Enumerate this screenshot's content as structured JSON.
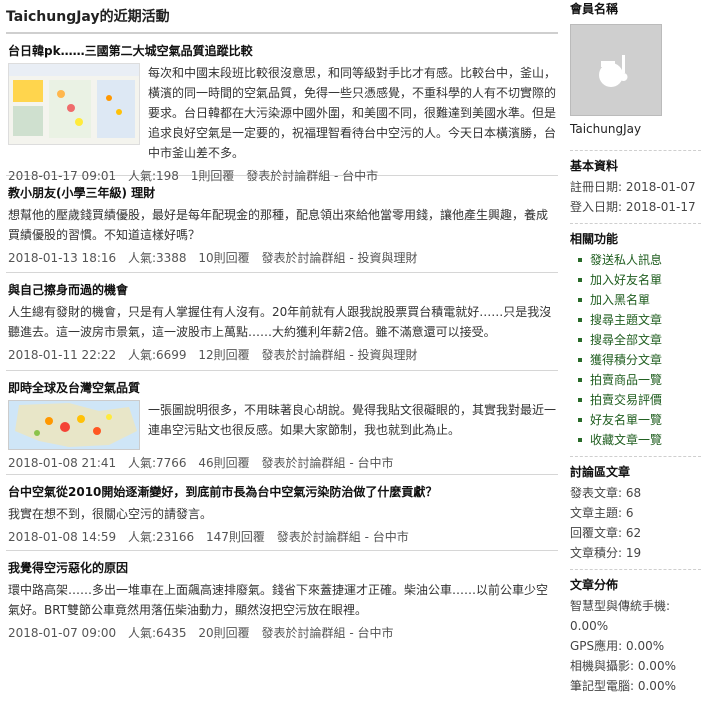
{
  "header": {
    "title": "TaichungJay的近期活動"
  },
  "posts": [
    {
      "title": "台日韓pk……三國第二大城空氣品質追蹤比較",
      "body": "每次和中國末段班比較很沒意思，和同等級對手比才有感。比較台中，釜山，橫濱的同一時間的空氣品質，免得一些只憑感覺，不重科學的人有不切實際的要求。台日韓都在大污染源中國外圍，和美國不同，很難達到美國水準。但是追求良好空氣是一定要的，祝福理智看待台中空污的人。今天日本橫濱勝，台中市釜山差不多。",
      "date": "2018-01-17 09:01",
      "views": "人氣:198",
      "replies": "1則回覆",
      "forum": "發表於討論群組 - 台中市"
    },
    {
      "title": "教小朋友(小學三年級) 理財",
      "body": "想幫他的壓歲錢買績優股，最好是每年配現金的那種，配息領出來給他當零用錢，讓他產生興趣，養成買績優股的習慣。不知道這樣好嗎？",
      "date": "2018-01-13 18:16",
      "views": "人氣:3388",
      "replies": "10則回覆",
      "forum": "發表於討論群組 - 投資與理財"
    },
    {
      "title": "與自己擦身而過的機會",
      "body": "人生總有發財的機會，只是有人掌握住有人沒有。20年前就有人跟我說股票買台積電就好……只是我沒聽進去。這一波房市景氣，這一波股市上萬點……大約獲利年薪2倍。雖不滿意還可以接受。",
      "date": "2018-01-11 22:22",
      "views": "人氣:6699",
      "replies": "12則回覆",
      "forum": "發表於討論群組 - 投資與理財"
    },
    {
      "title": "即時全球及台灣空氣品質",
      "body": "一張圖說明很多，不用昧著良心胡說。覺得我貼文很礙眼的，其實我對最近一連串空污貼文也很反感。如果大家節制，我也就到此為止。",
      "date": "2018-01-08 21:41",
      "views": "人氣:7766",
      "replies": "46則回覆",
      "forum": "發表於討論群組 - 台中市"
    },
    {
      "title": "台中空氣從2010開始逐漸變好，到底前市長為台中空氣污染防治做了什麼貢獻？",
      "body": "我實在想不到，很關心空污的請發言。",
      "date": "2018-01-08 14:59",
      "views": "人氣:23166",
      "replies": "147則回覆",
      "forum": "發表於討論群組 - 台中市"
    },
    {
      "title": "我覺得空污惡化的原因",
      "body": "環中路高架……多出一堆車在上面飆高速排廢氣。錢省下來蓋捷運才正確。柴油公車……以前公車少空氣好。BRT雙節公車竟然用落伍柴油動力，顯然沒把空污放在眼裡。",
      "date": "2018-01-07 09:00",
      "views": "人氣:6435",
      "replies": "20則回覆",
      "forum": "發表於討論群組 - 台中市"
    }
  ],
  "sidebar": {
    "member_title": "會員名稱",
    "username": "TaichungJay",
    "basic_title": "基本資料",
    "register": "註冊日期: 2018-01-07",
    "login": "登入日期: 2018-01-17",
    "functions_title": "相關功能",
    "functions": [
      "發送私人訊息",
      "加入好友名單",
      "加入黑名單",
      "搜尋主題文章",
      "搜尋全部文章",
      "獲得積分文章",
      "拍賣商品一覽",
      "拍賣交易評價",
      "好友名單一覽",
      "收藏文章一覽"
    ],
    "forum_title": "討論區文章",
    "forum_stats": [
      "發表文章: 68",
      "文章主題: 6",
      "回覆文章: 62",
      "文章積分: 19"
    ],
    "dist_title": "文章分佈",
    "dist": [
      "智慧型與傳統手機:",
      "0.00%",
      "GPS應用: 0.00%",
      "相機與攝影: 0.00%",
      "筆記型電腦: 0.00%"
    ]
  }
}
